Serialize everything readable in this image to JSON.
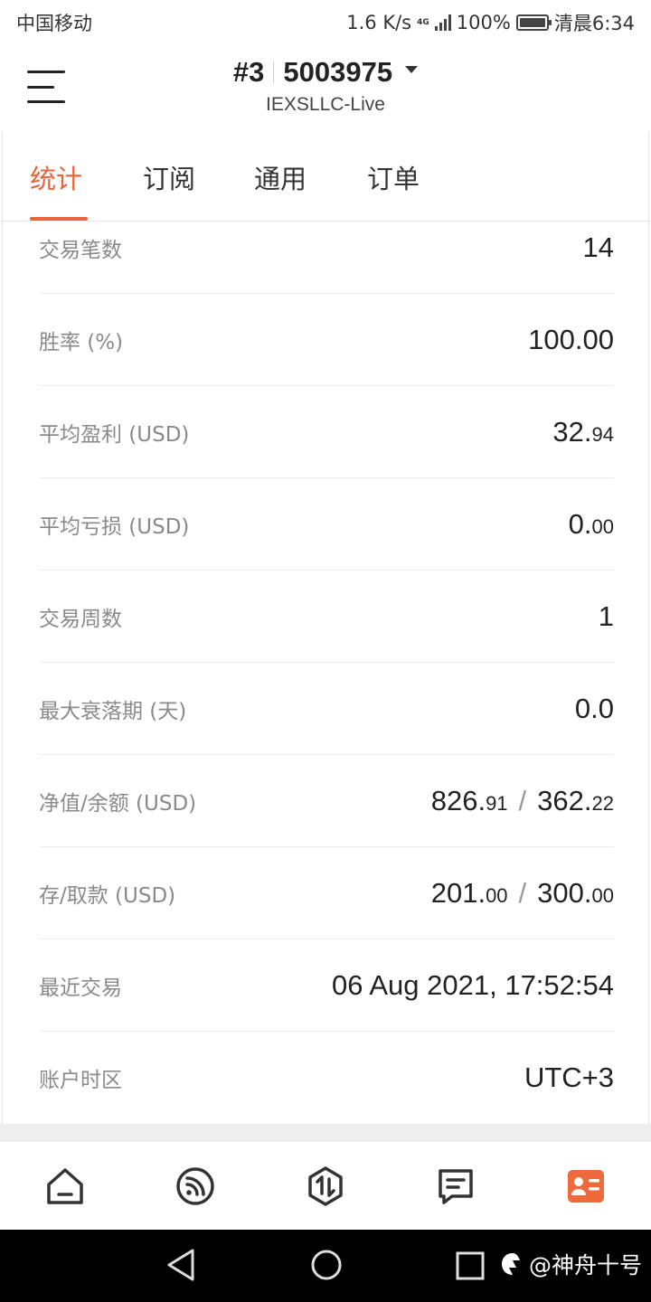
{
  "status_bar": {
    "carrier": "中国移动",
    "speed": "1.6 K/s",
    "network": "4G",
    "battery": "100%",
    "time": "清晨6:34"
  },
  "header": {
    "account_number": "#3",
    "account_id": "5003975",
    "server": "IEXSLLC-Live"
  },
  "tabs": [
    {
      "label": "统计",
      "active": true
    },
    {
      "label": "订阅",
      "active": false
    },
    {
      "label": "通用",
      "active": false
    },
    {
      "label": "订单",
      "active": false
    }
  ],
  "stats": {
    "trades": {
      "label": "交易笔数",
      "value": "14"
    },
    "win_rate": {
      "label": "胜率 (%)",
      "value": "100.00"
    },
    "avg_profit": {
      "label": "平均盈利 (USD)",
      "int": "32.",
      "dec": "94"
    },
    "avg_loss": {
      "label": "平均亏损 (USD)",
      "int": "0.",
      "dec": "00"
    },
    "weeks": {
      "label": "交易周数",
      "value": "1"
    },
    "max_drawdown": {
      "label": "最大衰落期 (天)",
      "value": "0.0"
    },
    "equity_balance": {
      "label": "净值/余额 (USD)",
      "equity_int": "826.",
      "equity_dec": "91",
      "balance_int": "362.",
      "balance_dec": "22",
      "sep": "/"
    },
    "deposit_withdraw": {
      "label": "存/取款 (USD)",
      "deposit_int": "201.",
      "deposit_dec": "00",
      "withdraw_int": "300.",
      "withdraw_dec": "00",
      "sep": "/"
    },
    "last_trade": {
      "label": "最近交易",
      "value": "06 Aug 2021, 17:52:54"
    },
    "timezone": {
      "label": "账户时区",
      "value": "UTC+3"
    }
  },
  "bottom_nav": [
    {
      "icon": "home-icon",
      "active": false
    },
    {
      "icon": "feed-icon",
      "active": false
    },
    {
      "icon": "trade-icon",
      "active": false
    },
    {
      "icon": "message-icon",
      "active": false
    },
    {
      "icon": "account-card-icon",
      "active": true
    }
  ],
  "watermark": "@神舟十号",
  "colors": {
    "accent": "#e8643a",
    "label": "#8a8a8a",
    "text": "#222222"
  }
}
